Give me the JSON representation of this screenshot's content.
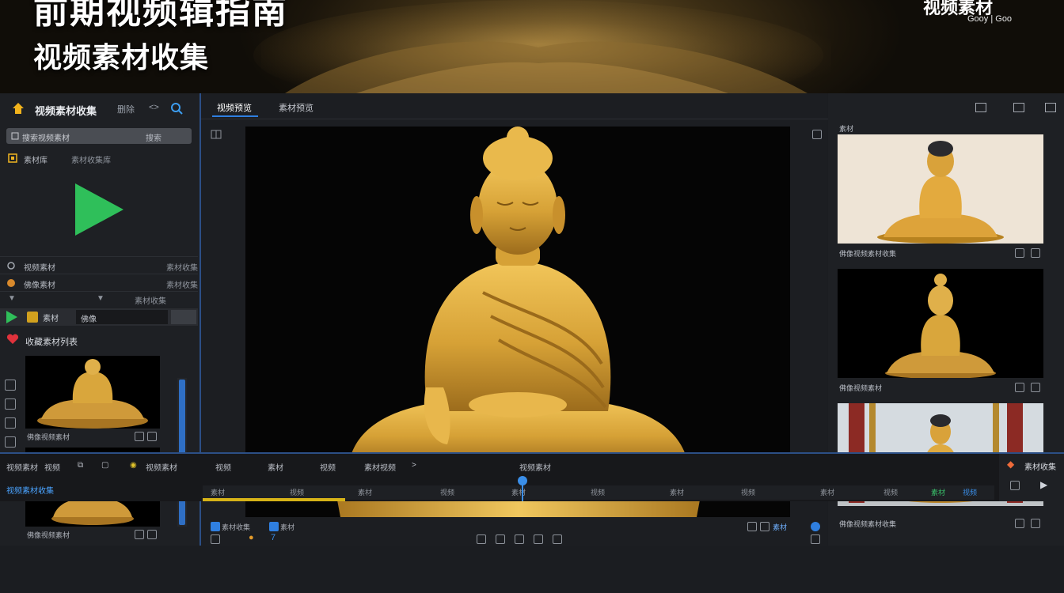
{
  "banner": {
    "title": "前期视频辑指南",
    "subtitle": "视频素材收集",
    "right_title": "视频素材",
    "right_sub": "Gooy | Goo"
  },
  "sidebar": {
    "title": "视频素材收集",
    "ctl_a": "删除",
    "ctl_b": "<>",
    "search_placeholder": "搜索视频素材",
    "search_action": "搜索",
    "row1_label": "素材库",
    "row1_value": "素材收集库",
    "row2_label": "视频素材",
    "row2_value": "素材收集",
    "row3_label": "佛像素材",
    "row3_value": "素材收集",
    "row4_a": "▼",
    "row4_b": "▼",
    "row4_c": "素材收集",
    "play_seg": "素材",
    "play_box": "佛像",
    "favorites": "收藏素材列表",
    "thumb1_caption": "佛像视频素材",
    "thumb2_caption": "佛像视频素材"
  },
  "preview": {
    "tab1": "视频预览",
    "tab2": "素材预览",
    "foot_left_a": "素材收集",
    "foot_left_b": "素材",
    "foot_right": "素材",
    "foot_num": "7"
  },
  "rpanel": {
    "label": "素材",
    "cap1": "佛像视频素材收集",
    "cap2": "佛像视频素材",
    "cap3": "佛像视频素材收集"
  },
  "timeline": {
    "t1": "视频素材",
    "t2": "视频",
    "t3": "视频素材",
    "t4": "视频",
    "t5": "素材",
    "t6": "视频",
    "t7": "素材视频",
    "t8": ">",
    "t9": "视频素材",
    "left_label": "视频素材收集",
    "ruler": [
      "素材",
      "视频",
      "素材",
      "视频",
      "素材",
      "视频",
      "素材",
      "视频",
      "素材",
      "视频",
      "素材",
      "视频"
    ],
    "right_label": "素材收集"
  },
  "colors": {
    "accent": "#2f7fe0",
    "play_green": "#2fbf5a",
    "gold": "#d9a63c"
  }
}
